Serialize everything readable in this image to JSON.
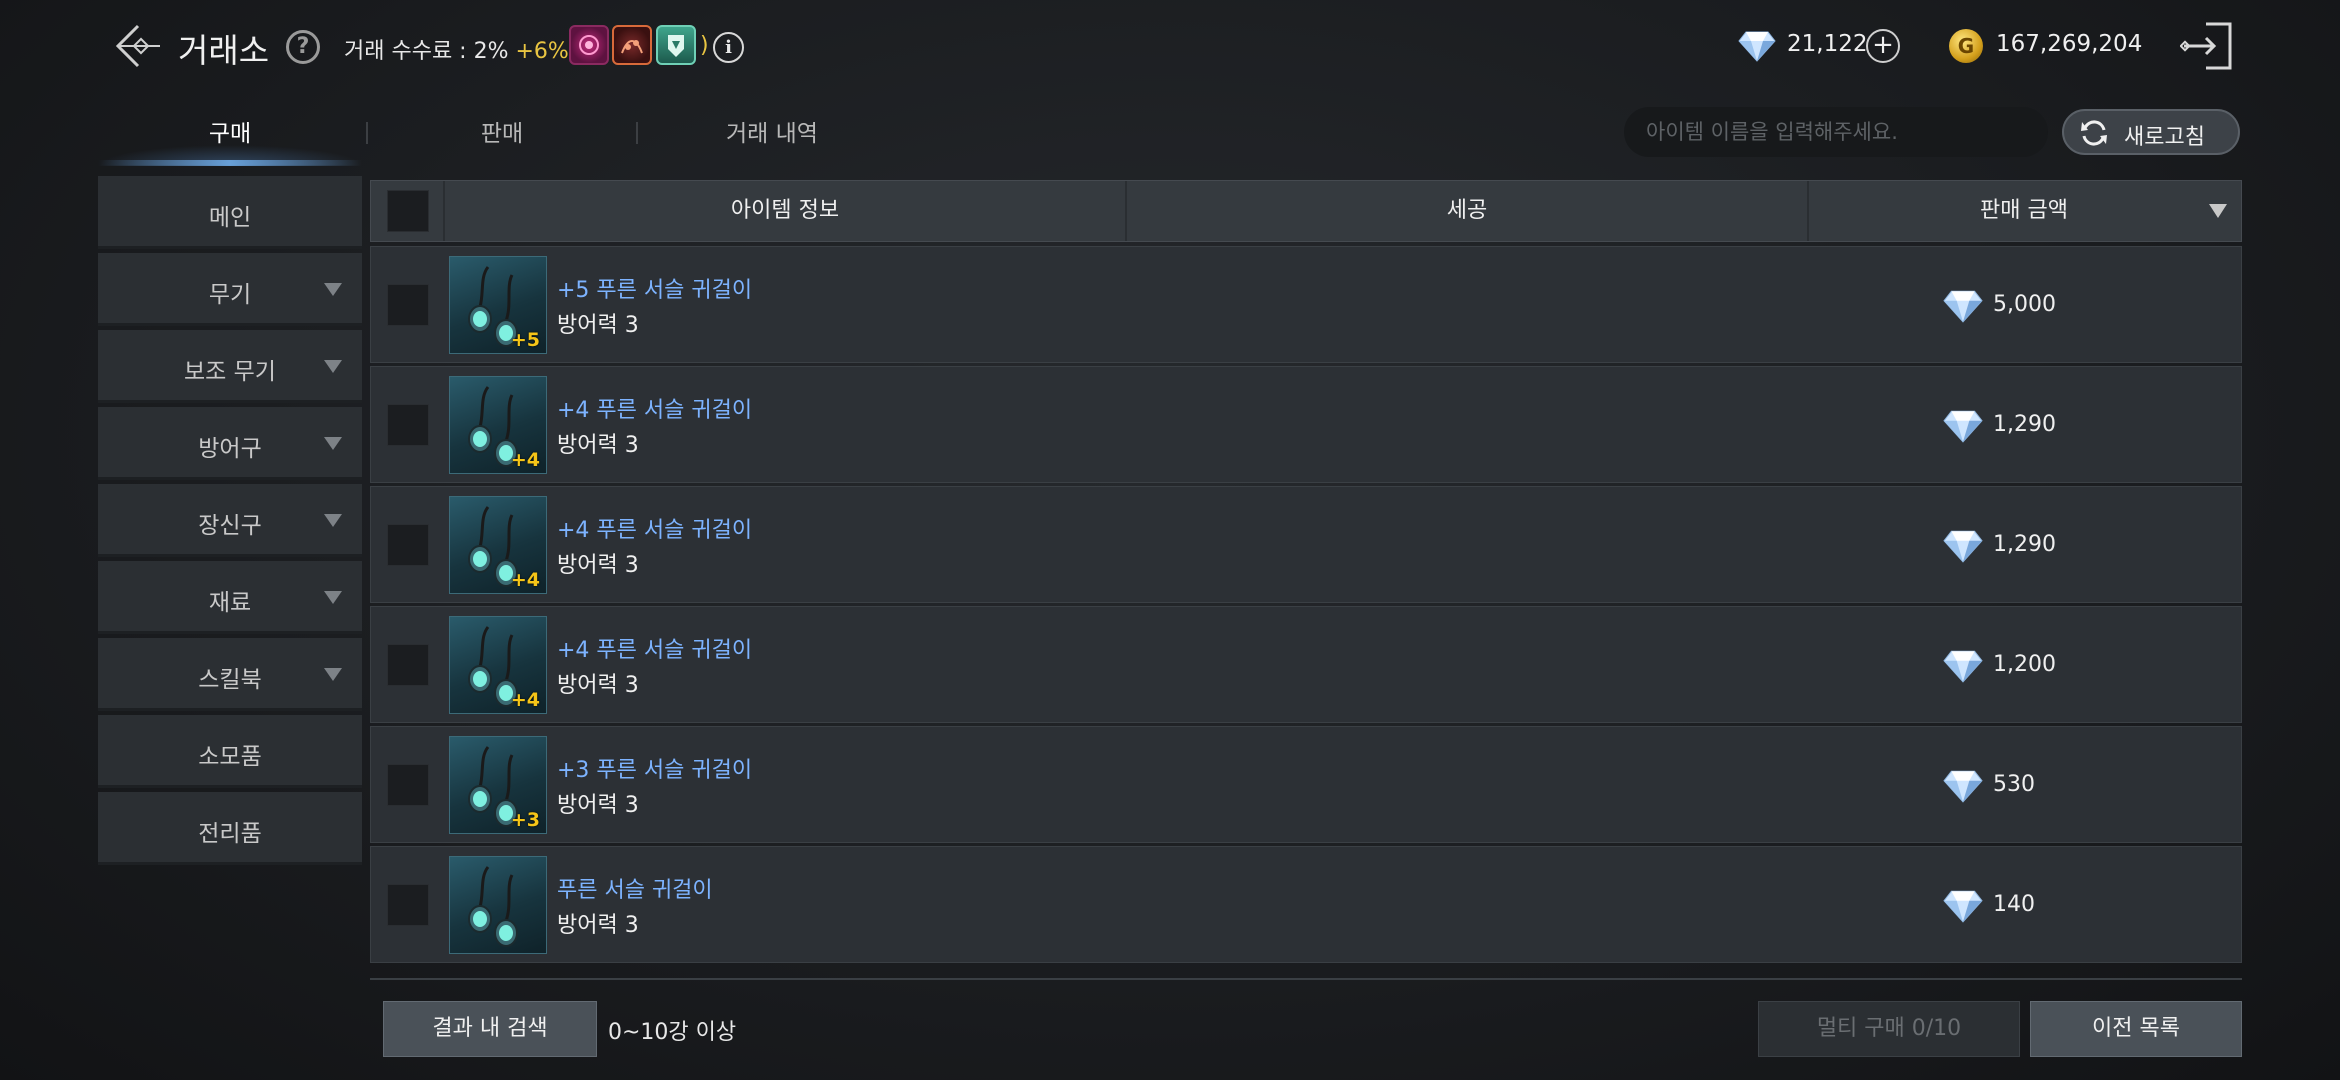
{
  "header": {
    "title": "거래소",
    "fee_label": "거래 수수료 : 2%",
    "fee_bonus": "+6%",
    "paren_open": "(",
    "paren_close": ")",
    "diamonds": "21,122",
    "gold": "167,269,204",
    "gold_icon_letter": "G"
  },
  "tabs": [
    {
      "label": "구매",
      "active": true
    },
    {
      "label": "판매",
      "active": false
    },
    {
      "label": "거래 내역",
      "active": false
    }
  ],
  "search": {
    "placeholder": "아이템 이름을 입력해주세요.",
    "refresh_label": "새로고침"
  },
  "sidebar": {
    "items": [
      {
        "label": "메인",
        "has_arrow": false
      },
      {
        "label": "무기",
        "has_arrow": true
      },
      {
        "label": "보조 무기",
        "has_arrow": true
      },
      {
        "label": "방어구",
        "has_arrow": true
      },
      {
        "label": "장신구",
        "has_arrow": true
      },
      {
        "label": "재료",
        "has_arrow": true
      },
      {
        "label": "스킬북",
        "has_arrow": true
      },
      {
        "label": "소모품",
        "has_arrow": false
      },
      {
        "label": "전리품",
        "has_arrow": false
      }
    ]
  },
  "table": {
    "columns": [
      "아이템 정보",
      "세공",
      "판매 금액"
    ],
    "rows": [
      {
        "name": "+5 푸른 서슬 귀걸이",
        "stat": "방어력 3",
        "enhance": "+5",
        "price": "5,000"
      },
      {
        "name": "+4 푸른 서슬 귀걸이",
        "stat": "방어력 3",
        "enhance": "+4",
        "price": "1,290"
      },
      {
        "name": "+4 푸른 서슬 귀걸이",
        "stat": "방어력 3",
        "enhance": "+4",
        "price": "1,290"
      },
      {
        "name": "+4 푸른 서슬 귀걸이",
        "stat": "방어력 3",
        "enhance": "+4",
        "price": "1,200"
      },
      {
        "name": "+3 푸른 서슬 귀걸이",
        "stat": "방어력 3",
        "enhance": "+3",
        "price": "530"
      },
      {
        "name": "푸른 서슬 귀걸이",
        "stat": "방어력 3",
        "enhance": "",
        "price": "140"
      }
    ]
  },
  "footer": {
    "search_in_results": "결과 내 검색",
    "enhance_filter": "0~10강 이상",
    "multi_buy": "멀티 구매 0/10",
    "prev_list": "이전 목록"
  },
  "colors": {
    "accent_blue": "#7db3ff",
    "fee_bonus": "#e9c542",
    "enhance_gold": "#f5c518"
  }
}
